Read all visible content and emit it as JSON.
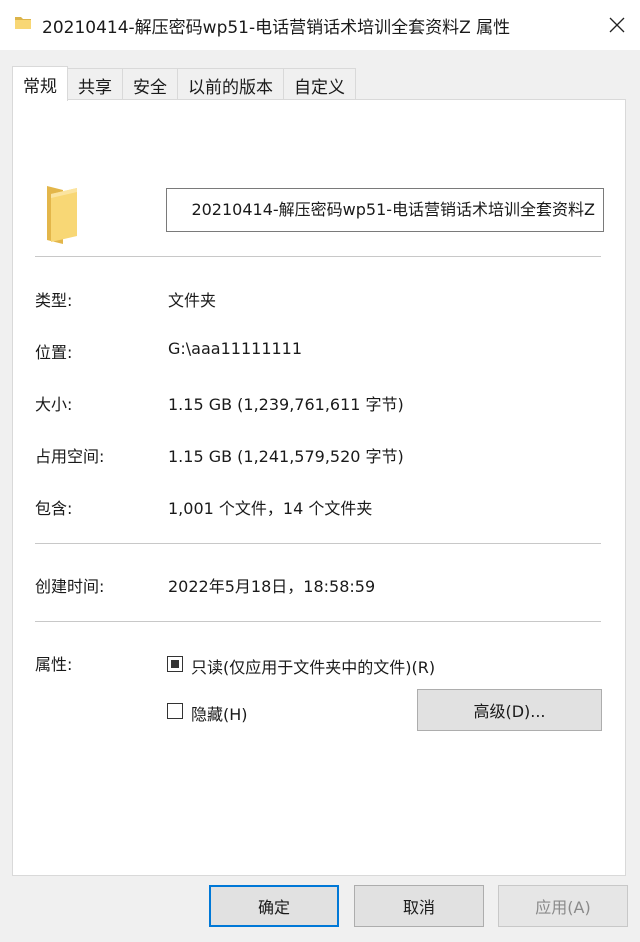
{
  "window": {
    "title": "20210414-解压密码wp51-电话营销话术培训全套资料Z 属性",
    "icon": "folder-icon"
  },
  "tabs": [
    {
      "label": "常规",
      "active": true
    },
    {
      "label": "共享",
      "active": false
    },
    {
      "label": "安全",
      "active": false
    },
    {
      "label": "以前的版本",
      "active": false
    },
    {
      "label": "自定义",
      "active": false
    }
  ],
  "general": {
    "name_value": "20210414-解压密码wp51-电话营销话术培训全套资料Z",
    "type": {
      "label": "类型:",
      "value": "文件夹"
    },
    "location": {
      "label": "位置:",
      "value": "G:\\aaa11111111"
    },
    "size": {
      "label": "大小:",
      "value": "1.15 GB (1,239,761,611 字节)"
    },
    "size_on_disk": {
      "label": "占用空间:",
      "value": "1.15 GB (1,241,579,520 字节)"
    },
    "contains": {
      "label": "包含:",
      "value": "1,001 个文件，14 个文件夹"
    },
    "created": {
      "label": "创建时间:",
      "value": "2022年5月18日，18:58:59"
    },
    "attributes": {
      "label": "属性:",
      "readonly_label": "只读(仅应用于文件夹中的文件)(R)",
      "readonly_state": "indeterminate",
      "hidden_label": "隐藏(H)",
      "hidden_state": "unchecked",
      "advanced_button": "高级(D)..."
    }
  },
  "buttons": {
    "ok": "确定",
    "cancel": "取消",
    "apply": "应用(A)"
  },
  "colors": {
    "accent": "#0078d7",
    "folder": "#f8d775"
  }
}
